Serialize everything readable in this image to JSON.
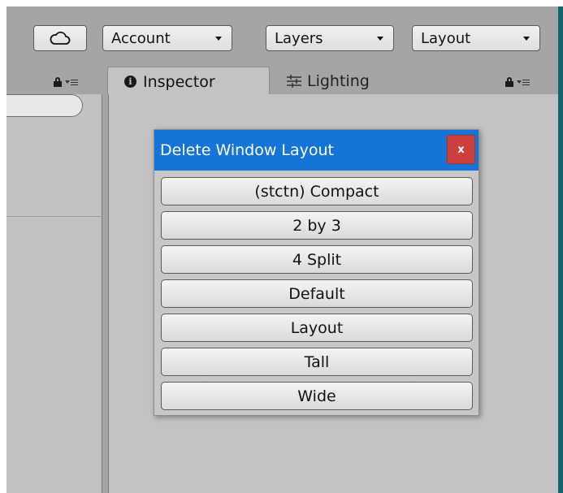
{
  "toolbar": {
    "cloud_icon": "cloud-icon",
    "account_label": "Account",
    "layers_label": "Layers",
    "layout_label": "Layout"
  },
  "tabs": {
    "inspector_label": "Inspector",
    "inspector_icon": "info-icon",
    "lighting_label": "Lighting",
    "lighting_icon": "sliders-icon"
  },
  "dialog": {
    "title": "Delete Window Layout",
    "close_label": "x",
    "layouts": [
      "(stctn) Compact",
      "2 by 3",
      "4 Split",
      "Default",
      "Layout",
      "Tall",
      "Wide"
    ]
  },
  "colors": {
    "title_bar": "#1574d8",
    "close_button": "#c9403e",
    "background": "#a5a5a5",
    "panel": "#c3c3c3",
    "right_edge": "#12656b"
  }
}
